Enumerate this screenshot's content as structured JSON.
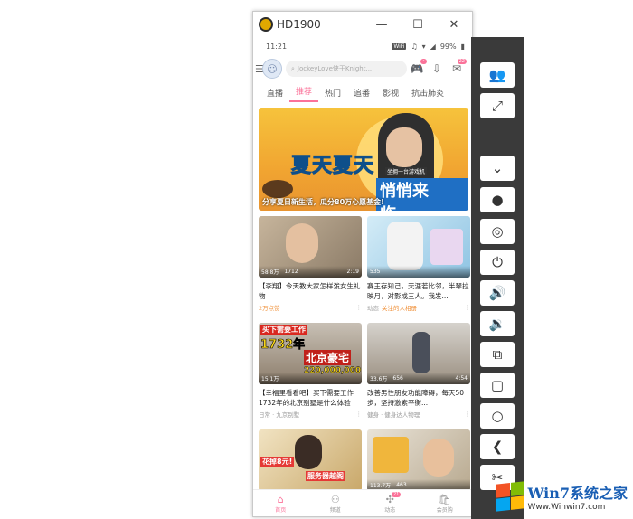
{
  "window": {
    "title": "HD1900",
    "controls": {
      "minimize": "—",
      "maximize": "☐",
      "close": "✕"
    }
  },
  "statusbar": {
    "time": "11:21",
    "wifi_badge": "WiFi",
    "battery": "99%"
  },
  "header": {
    "search_placeholder": "JockeyLove侠于Knight..."
  },
  "tabs": [
    {
      "label": "直播"
    },
    {
      "label": "推荐"
    },
    {
      "label": "热门"
    },
    {
      "label": "追番"
    },
    {
      "label": "影视"
    },
    {
      "label": "抗击肺炎"
    }
  ],
  "banner": {
    "title1": "夏天夏天",
    "title2": "悄悄来临……",
    "subtitle": "分享夏日新生活，瓜分80万心愿基金!",
    "tag": "坐拥一台游戏机"
  },
  "cards": [
    {
      "views": "58.8万",
      "comments": "1712",
      "duration": "2:19",
      "title": "【李翔】今天教大家怎样泼女生礼物",
      "meta": "2万点赞",
      "meta_style": "tag"
    },
    {
      "views": "535",
      "comments": "",
      "duration": "",
      "title": "赛王存知己，天涯若比邻，半琴拉映月，对影成三人。我发...",
      "meta": "关注的人相册",
      "meta_prefix": "动态"
    },
    {
      "views": "15.1万",
      "comments": "",
      "duration": "",
      "title": "【幸福里看看吧】买下需要工作1732年的北京别墅是什么体验",
      "meta": "日常 · 九京别墅",
      "overlay1": "买下需要工作",
      "overlay2": "1732年",
      "overlay3": "北京豪宅",
      "overlay4": "220,000,000"
    },
    {
      "views": "33.6万",
      "comments": "656",
      "duration": "4:54",
      "title": "改善男性朋友功能障碍，每天50步，坚持激素平衡...",
      "meta": "健身 · 健身达人物理"
    },
    {
      "views": "",
      "comments": "",
      "duration": "",
      "title": "",
      "meta": "",
      "overlay1": "花掉8元!",
      "overlay2": "服务器越阁"
    },
    {
      "views": "113.7万",
      "comments": "463",
      "duration": "",
      "title": "",
      "meta": ""
    }
  ],
  "bottomnav": [
    {
      "label": "首页",
      "icon": "home-icon"
    },
    {
      "label": "频道",
      "icon": "channel-icon"
    },
    {
      "label": "动态",
      "icon": "feed-icon",
      "badge": "21"
    },
    {
      "label": "会员购",
      "icon": "shop-icon"
    }
  ],
  "side_toolbar": [
    {
      "icon": "group-icon",
      "glyph": "👥"
    },
    {
      "icon": "fullscreen-icon",
      "glyph": "⤢"
    },
    {
      "icon": "collapse-icon",
      "glyph": "⌄"
    },
    {
      "icon": "record-icon",
      "glyph": "●"
    },
    {
      "icon": "hide-icon",
      "glyph": "◎"
    },
    {
      "icon": "power-icon",
      "glyph": "⏻"
    },
    {
      "icon": "volume-up-icon",
      "glyph": "🔊"
    },
    {
      "icon": "volume-down-icon",
      "glyph": "🔉"
    },
    {
      "icon": "rotate-icon",
      "glyph": "⧉"
    },
    {
      "icon": "overview-icon",
      "glyph": "▢"
    },
    {
      "icon": "home-icon",
      "glyph": "○"
    },
    {
      "icon": "back-icon",
      "glyph": "❮"
    },
    {
      "icon": "screenshot-icon",
      "glyph": "✂"
    }
  ],
  "watermark": {
    "main": "Win7系统之家",
    "url": "Www.Winwin7.com"
  },
  "colors": {
    "accent": "#fb7299",
    "toolbar": "#3a3a3a"
  }
}
